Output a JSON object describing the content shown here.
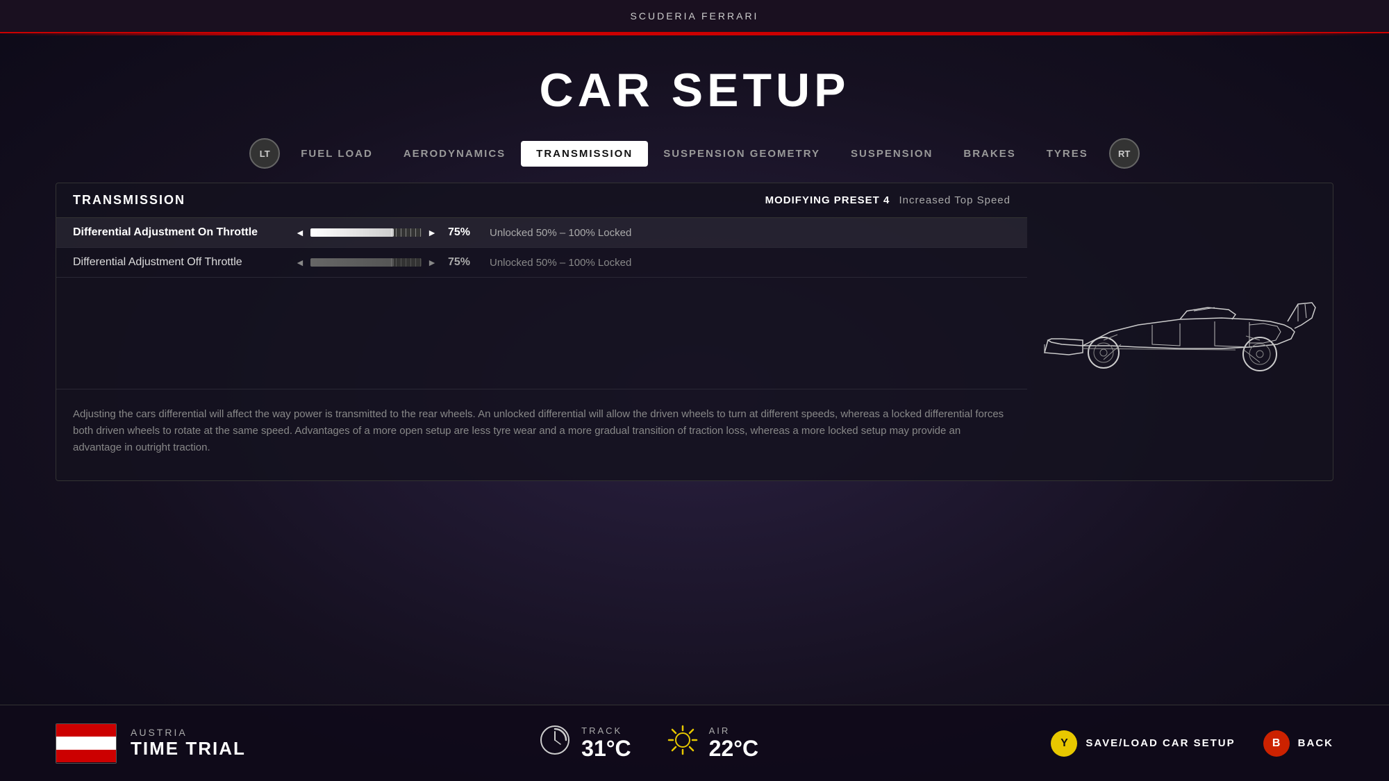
{
  "top_bar": {
    "title": "SCUDERIA FERRARI"
  },
  "page": {
    "title": "CAR SETUP"
  },
  "nav": {
    "left_button": "LT",
    "right_button": "RT",
    "tabs": [
      {
        "id": "fuel-load",
        "label": "FUEL LOAD",
        "active": false
      },
      {
        "id": "aerodynamics",
        "label": "AERODYNAMICS",
        "active": false
      },
      {
        "id": "transmission",
        "label": "TRANSMISSION",
        "active": true
      },
      {
        "id": "suspension-geometry",
        "label": "SUSPENSION GEOMETRY",
        "active": false
      },
      {
        "id": "suspension",
        "label": "SUSPENSION",
        "active": false
      },
      {
        "id": "brakes",
        "label": "BRAKES",
        "active": false
      },
      {
        "id": "tyres",
        "label": "TYRES",
        "active": false
      }
    ]
  },
  "section": {
    "title": "TRANSMISSION",
    "preset_label": "MODIFYING PRESET",
    "preset_number": "4",
    "preset_name": "Increased Top Speed",
    "settings": [
      {
        "id": "diff-on-throttle",
        "name": "Differential Adjustment On Throttle",
        "value": 75,
        "percent": "75%",
        "description": "Unlocked 50% – 100% Locked",
        "active": true
      },
      {
        "id": "diff-off-throttle",
        "name": "Differential Adjustment Off Throttle",
        "value": 75,
        "percent": "75%",
        "description": "Unlocked 50% – 100% Locked",
        "active": false
      }
    ],
    "description": "Adjusting the cars differential will affect the way power is transmitted to the rear wheels. An unlocked differential will allow the driven wheels to turn at different speeds, whereas a locked differential forces both driven wheels to rotate at the same speed. Advantages of a more open setup are less tyre wear and a more gradual transition of traction loss, whereas a more locked setup may provide an advantage in outright traction."
  },
  "bottom": {
    "country": "AUSTRIA",
    "event_type": "TIME TRIAL",
    "track_label": "TRACK",
    "track_temp": "31°C",
    "air_label": "AIR",
    "air_temp": "22°C",
    "save_load_label": "SAVE/LOAD CAR SETUP",
    "back_label": "BACK",
    "y_button": "Y",
    "b_button": "B"
  }
}
